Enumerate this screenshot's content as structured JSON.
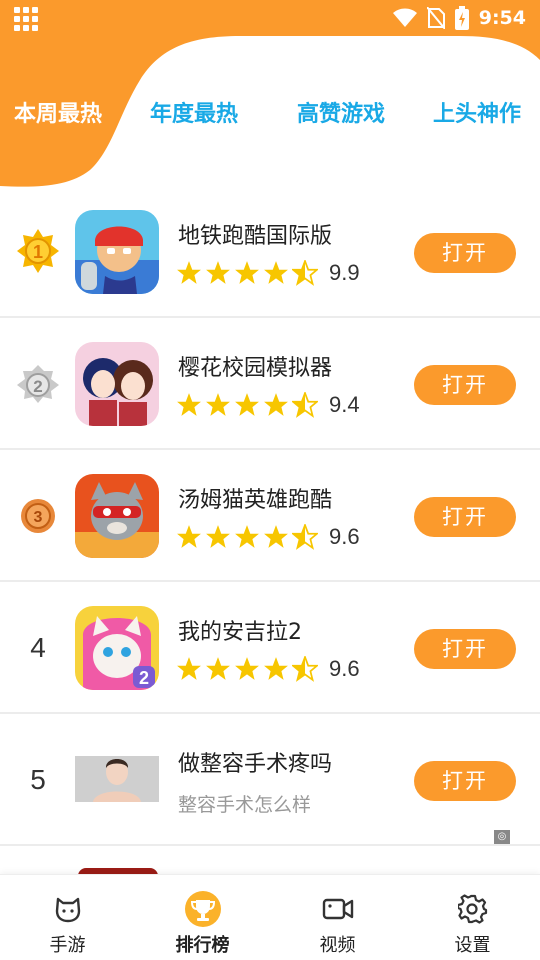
{
  "status_bar": {
    "time": "9:54"
  },
  "tabs": [
    {
      "label": "本周最热",
      "active": true
    },
    {
      "label": "年度最热",
      "active": false
    },
    {
      "label": "高赞游戏",
      "active": false
    },
    {
      "label": "上头神作",
      "active": false
    }
  ],
  "colors": {
    "accent": "#fb9a2c",
    "tab_inactive": "#19a9e6",
    "star": "#f7c600"
  },
  "apps": [
    {
      "rank": "1",
      "rank_style": "gold-medal",
      "name": "地铁跑酷国际版",
      "rating": 4.5,
      "score": "9.9",
      "button": "打开"
    },
    {
      "rank": "2",
      "rank_style": "silver-medal",
      "name": "樱花校园模拟器",
      "rating": 4.5,
      "score": "9.4",
      "button": "打开"
    },
    {
      "rank": "3",
      "rank_style": "bronze-medal",
      "name": "汤姆猫英雄跑酷",
      "rating": 4.5,
      "score": "9.6",
      "button": "打开"
    },
    {
      "rank": "4",
      "rank_style": "number",
      "name": "我的安吉拉2",
      "rating": 4.5,
      "score": "9.6",
      "button": "打开"
    }
  ],
  "ad": {
    "rank": "5",
    "title": "做整容手术疼吗",
    "subtitle": "整容手术怎么样",
    "button": "打开"
  },
  "bottom_nav": [
    {
      "label": "手游",
      "icon": "game-face-icon",
      "active": false
    },
    {
      "label": "排行榜",
      "icon": "trophy-icon",
      "active": true
    },
    {
      "label": "视频",
      "icon": "video-camera-icon",
      "active": false
    },
    {
      "label": "设置",
      "icon": "gear-icon",
      "active": false
    }
  ]
}
